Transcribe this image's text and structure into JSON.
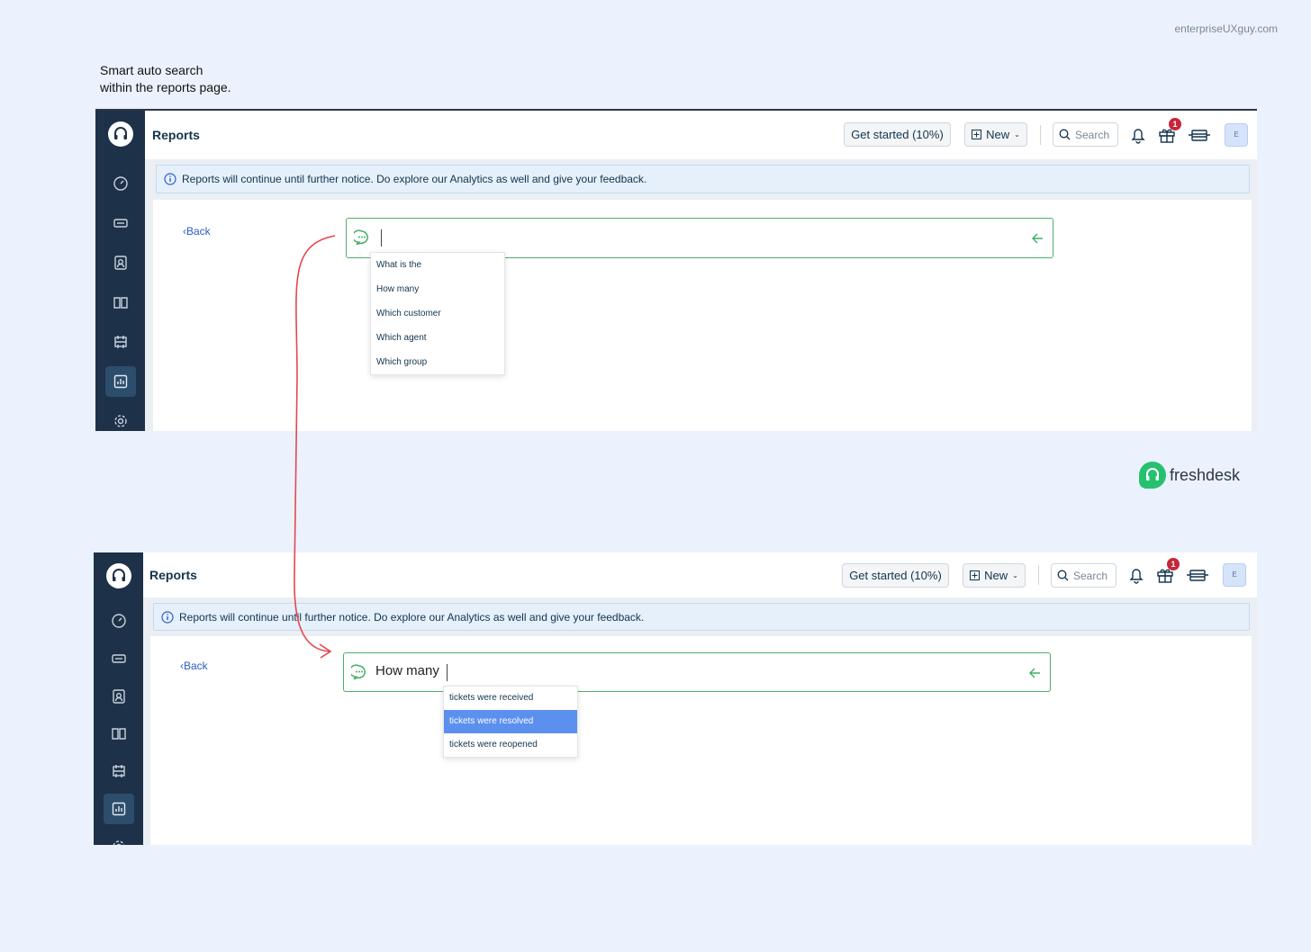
{
  "watermark": "enterpriseUXguy.com",
  "caption": {
    "line1": "Smart auto search",
    "line2": "within the reports page."
  },
  "brand": {
    "name": "freshdesk",
    "color": "#25c16f"
  },
  "colors": {
    "sidebar": "#1d3149",
    "accent_green": "#4caf6a",
    "selected_option": "#5c90ef",
    "badge": "#c8263a",
    "annotation_arrow": "#e5474d"
  },
  "screen1": {
    "page_title": "Reports",
    "get_started_label": "Get started (10%)",
    "new_label": "New",
    "search_placeholder": "Search",
    "notification_badge": "1",
    "avatar_letter": "E",
    "banner_text": "Reports will continue until further notice. Do explore our Analytics as well and give your feedback.",
    "back_label": "Back",
    "query_text": "",
    "suggestions": [
      "What is the",
      "How many",
      "Which customer",
      "Which agent",
      "Which group"
    ]
  },
  "screen2": {
    "page_title": "Reports",
    "get_started_label": "Get started (10%)",
    "new_label": "New",
    "search_placeholder": "Search",
    "notification_badge": "1",
    "avatar_letter": "E",
    "banner_text": "Reports will continue until further notice. Do explore our Analytics as well and give your feedback.",
    "back_label": "Back",
    "query_text": "How many",
    "suggestions": [
      "tickets were received",
      "tickets were resolved",
      "tickets were reopened"
    ],
    "selected_suggestion": "tickets were resolved"
  },
  "sidebar_icons": [
    "dashboard-icon",
    "tickets-icon",
    "contacts-icon",
    "solutions-icon",
    "forums-icon",
    "reports-icon",
    "admin-icon"
  ]
}
